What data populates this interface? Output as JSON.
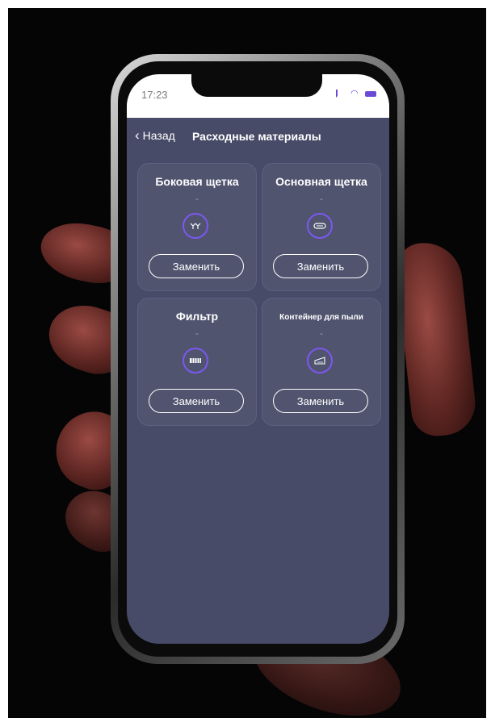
{
  "status_bar": {
    "time": "17:23"
  },
  "nav": {
    "back_label": "Назад",
    "title": "Расходные материалы"
  },
  "accent_color": "#7b58f0",
  "cards": [
    {
      "name": "Боковая щетка",
      "status": "-",
      "icon": "side-brush-icon",
      "button": "Заменить"
    },
    {
      "name": "Основная щетка",
      "status": "-",
      "icon": "main-brush-icon",
      "button": "Заменить"
    },
    {
      "name": "Фильтр",
      "status": "-",
      "icon": "filter-icon",
      "button": "Заменить"
    },
    {
      "name": "Контейнер для пыли",
      "status": "-",
      "icon": "dust-container-icon",
      "button": "Заменить"
    }
  ]
}
